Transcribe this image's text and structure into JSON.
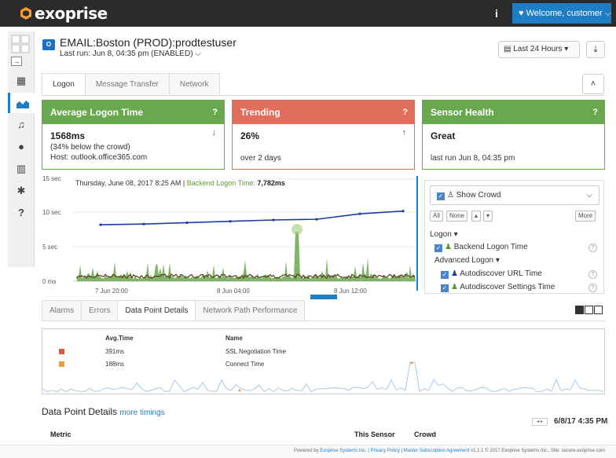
{
  "brand": {
    "name": "exoprise",
    "colors": {
      "topbar": "#2b2b2b",
      "accent": "#1d7ec5",
      "good": "#6aa84f",
      "bad": "#e06e5d"
    }
  },
  "topbar": {
    "info_icon": "info-icon",
    "welcome": "♥ Welcome, customer ⌵"
  },
  "sidebar": {
    "icons": [
      "dashboard-icon",
      "chart-icon",
      "bell-icon",
      "map-pin-icon",
      "bank-icon",
      "gear-icon",
      "help-icon"
    ],
    "help_label": "?"
  },
  "header": {
    "badge": "O",
    "title": "EMAIL:Boston (PROD):prodtestuser",
    "subtitle": "Last run: Jun 8, 04:35 pm (ENABLED) ⌵",
    "range": "Last 24 Hours ▾",
    "download": "⤓"
  },
  "tabs": [
    {
      "label": "Logon"
    },
    {
      "label": "Message Transfer"
    },
    {
      "label": "Network"
    }
  ],
  "collapse_label": "˄",
  "cards": {
    "logon": {
      "title": "Average Logon Time",
      "value": "1568ms",
      "line2": "(34% below the crowd)",
      "line3": "Host: outlook.office365.com",
      "arrow": "↓",
      "help": "?"
    },
    "trend": {
      "title": "Trending",
      "value": "26%",
      "line2": "over 2 days",
      "arrow": "↑",
      "help": "?"
    },
    "health": {
      "title": "Sensor Health",
      "value": "Great",
      "line2": "last run Jun 8, 04:35 pm",
      "help": "?"
    }
  },
  "chart_tooltip": {
    "date": "Thursday, June 08, 2017 8:25 AM",
    "sep": " | ",
    "metric": "Backend Logon Time:",
    "value": "7,782ms"
  },
  "chart_data": {
    "type": "line",
    "ylim": [
      0,
      15
    ],
    "y_ticks": [
      "15 sec",
      "10 sec",
      "5 sec",
      "0 ms"
    ],
    "x_ticks": [
      "7 Jun 20:00",
      "8 Jun 04:00",
      "8 Jun 12:00"
    ],
    "series": [
      {
        "name": "Backend Logon Time",
        "color": "#6aa84f"
      },
      {
        "name": "Autodiscover URL Time",
        "color": "#1d3c9c"
      },
      {
        "name": "Autodiscover Settings Time",
        "color": "#6aa84f"
      }
    ],
    "crowd_line": [
      8.3,
      8.4,
      8.6,
      8.8,
      9.0,
      9.1,
      9.9,
      10.3
    ]
  },
  "legend": {
    "show_crowd": "Show Crowd",
    "all": "All",
    "none": "None",
    "up": "▴",
    "down": "▾",
    "more": "More",
    "logon_group": "Logon ▾",
    "backend": "Backend Logon Time",
    "advanced_group": "Advanced Logon ▾",
    "autodiscover_url": "Autodiscover URL Time",
    "autodiscover_settings": "Autodiscover Settings Time",
    "help": "?"
  },
  "bottom_tabs": [
    {
      "label": "Alarms"
    },
    {
      "label": "Errors"
    },
    {
      "label": "Data Point Details"
    },
    {
      "label": "Network Path Performance"
    }
  ],
  "dp_table": {
    "headers": {
      "avg": "Avg.Time",
      "name": "Name"
    },
    "rows": [
      {
        "avg": "391ms",
        "name": "SSL Negotiation Time",
        "color": "#e0533c"
      },
      {
        "avg": "188ms",
        "name": "Connect Time",
        "color": "#f39c33"
      }
    ]
  },
  "dp_details": {
    "title": "Data Point Details",
    "more": "more timings",
    "nav": "◂ ▸",
    "time": "6/8/17 4:35 PM",
    "col_metric": "Metric",
    "col_sensor": "This Sensor",
    "col_crowd": "Crowd"
  },
  "footer": {
    "powered": "Powered by",
    "company": "Exoprise Systems Inc.",
    "sep": " | ",
    "privacy": "Privacy Policy",
    "msa": "Master Subscription Agreement",
    "version": "v1.1.1 © 2017 Exoprise Systems Inc., Site: secure.exoprise.com"
  }
}
